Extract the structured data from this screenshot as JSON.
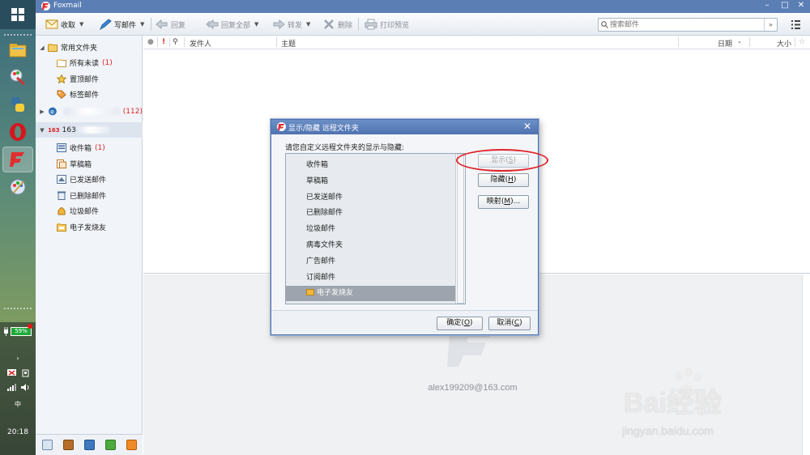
{
  "titlebar": {
    "title": "Foxmail"
  },
  "toolbar": {
    "receive": "收取",
    "compose": "写邮件",
    "reply": "回复",
    "reply_all": "回复全部",
    "forward": "转发",
    "delete": "删除",
    "print_preview": "打印预览"
  },
  "search": {
    "placeholder": "搜索邮件"
  },
  "folders": {
    "common": "常用文件夹",
    "unread": "所有未读",
    "unread_count": "(1)",
    "pinned": "置顶邮件",
    "tagged": "标签邮件",
    "account1_count": "(112)",
    "account2_badge": "163",
    "account2_name": "163",
    "inbox": "收件箱",
    "inbox_count": "(1)",
    "drafts": "草稿箱",
    "sent": "已发送邮件",
    "deleted": "已删除邮件",
    "junk": "垃圾邮件",
    "efriend": "电子发烧友"
  },
  "list_header": {
    "sender": "发件人",
    "subject": "主题",
    "date": "日期",
    "size": "大小"
  },
  "preview": {
    "email": "alex199209@163.com"
  },
  "dialog": {
    "title": "显示/隐藏 远程文件夹",
    "prompt": "请您自定义远程文件夹的显示与隐藏:",
    "items": [
      "收件箱",
      "草稿箱",
      "已发送邮件",
      "已删除邮件",
      "垃圾邮件",
      "病毒文件夹",
      "广告邮件",
      "订阅邮件",
      "电子发烧友"
    ],
    "show_label": "显示",
    "show_key": "S",
    "hide_label": "隐藏",
    "hide_key": "H",
    "map_label": "映射",
    "map_key": "M",
    "ok_label": "确定",
    "ok_key": "O",
    "cancel_label": "取消",
    "cancel_key": "C"
  },
  "tray": {
    "battery": "59%",
    "ime": "中",
    "time": "20:18"
  },
  "watermark": {
    "brand": "Bai经验",
    "url": "jingyan.baidu.com"
  },
  "colors": {
    "titlebar": "#5b7fb5",
    "accent_red": "#e0232b",
    "selection": "#9da4ad"
  }
}
